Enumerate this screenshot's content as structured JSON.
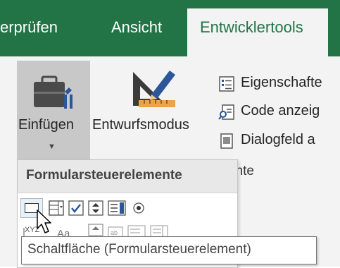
{
  "tabs": {
    "partial_left": "erprüfen",
    "ansicht": "Ansicht",
    "active": "Entwicklertools"
  },
  "ribbon": {
    "einfuegen_label": "Einfügen",
    "entwurfsmodus_label": "Entwurfsmodus",
    "eigenschaften_label": "Eigenschafte",
    "code_anzeigen_label": "Code anzeig",
    "dialogfeld_label": "Dialogfeld a",
    "group_label_partial": "ente"
  },
  "dropdown": {
    "header": "Formularsteuerelemente",
    "controls": [
      "button-control-icon",
      "combo-box-control-icon",
      "checkbox-control-icon",
      "spin-button-control-icon",
      "list-box-control-icon",
      "option-button-control-icon",
      "group-box-control-icon",
      "label-control-icon",
      "scroll-bar-control-icon",
      "text-field-control-icon",
      "combo-list-control-icon",
      "combo-dropdown-control-icon"
    ]
  },
  "tooltip": {
    "text": "Schaltfläche (Formularsteuerelement)"
  },
  "colors": {
    "tab_bar": "#227447",
    "ribbon_bg": "#f3f3f3",
    "pressed_button": "#c8c8c8",
    "accent_blue": "#2b579a"
  }
}
